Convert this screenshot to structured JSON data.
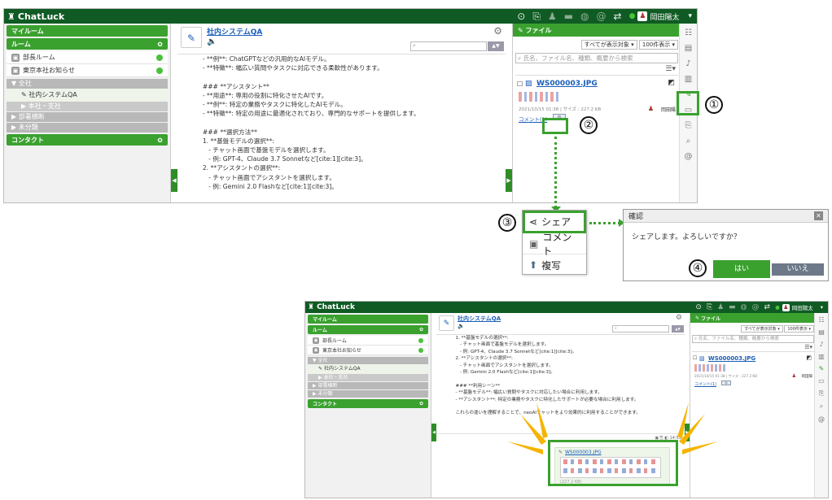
{
  "app": {
    "brand": "ChatLuck",
    "user_name": "岡田陽太"
  },
  "left": {
    "my_room": "マイルーム",
    "room": "ルーム",
    "rooms": [
      {
        "label": "部長ルーム"
      },
      {
        "label": "東京本社お知らせ"
      }
    ],
    "all": "全社",
    "all_rooms": [
      "社内システムQA",
      "本社・支社"
    ],
    "dept": "部署横断",
    "uncat": "未分類",
    "contact": "コンタクト"
  },
  "center": {
    "room_title": "社内システムQA",
    "messages_top": "  - **例**: ChatGPTなどの汎用的なAIモデル。\n  - **特徴**: 幅広い質問やタスクに対応できる柔軟性があります。\n\n  ### **アシスタント**\n  - **用途**: 専用の役割に特化させたAIです。\n  - **例**: 特定の業務やタスクに特化したAIモデル。\n  - **特徴**: 特定の用途に最適化されており、専門的なサポートを提供します。\n\n  ### **選択方法**\n  1. **基盤モデルの選択**:\n     - チャット画面で基盤モデルを選択します。\n     - 例: GPT-4、Claude 3.7 Sonnetなど[cite:1][cite:3]。\n  2. **アシスタントの選択**:\n     - チャット画面でアシスタントを選択します。\n     - 例: Gemini 2.0 Flashなど[cite:1][cite:3]。",
    "messages_bottom": "  1. **基盤モデルの選択**:\n     - チャット画面で基盤モデルを選択します。\n     - 例: GPT-4、Claude 3.7 Sonnetなど[cite:1][cite:3]。\n  2. **アシスタントの選択**:\n     - チャット画面でアシスタントを選択します。\n     - 例: Gemini 2.0 Flashなど[cite:1][cite:3]。\n\n  ### **利用シーン**\n  - **基盤モデル**: 幅広い質問やタスクに対応したい場合に利用します。\n  - **アシスタント**: 特定の業務やタスクに特化したサポートが必要な場合に利用します。\n\n  これらの違いを理解することで、neoAIチャットをより効果的に利用することができます。",
    "shared_file_name": "WS000003.JPG",
    "shared_file_size": "(227.2 KB)",
    "shared_time": "14:51"
  },
  "files": {
    "panel_title": "ファイル",
    "filter_selected": "すべてが表示対象",
    "page_size_selected": "100件表示",
    "search_placeholder": "氏名、ファイル名、種類、概要から検索",
    "file_name": "WS000003.JPG",
    "file_meta": "2021/10/15 01:38 | サイズ : 227.2 KB",
    "uploader": "岡田陽",
    "comment_link": "コメント(1)"
  },
  "menu": {
    "share": "シェア",
    "comment": "コメント",
    "copy": "複写"
  },
  "dialog": {
    "title": "確認",
    "message": "シェアします。よろしいですか？",
    "yes": "はい",
    "no": "いいえ"
  },
  "steps": [
    "①",
    "②",
    "③",
    "④"
  ],
  "colors": {
    "header": "#0f5b23",
    "accent": "#3aa12f",
    "callout": "#f5b400"
  }
}
